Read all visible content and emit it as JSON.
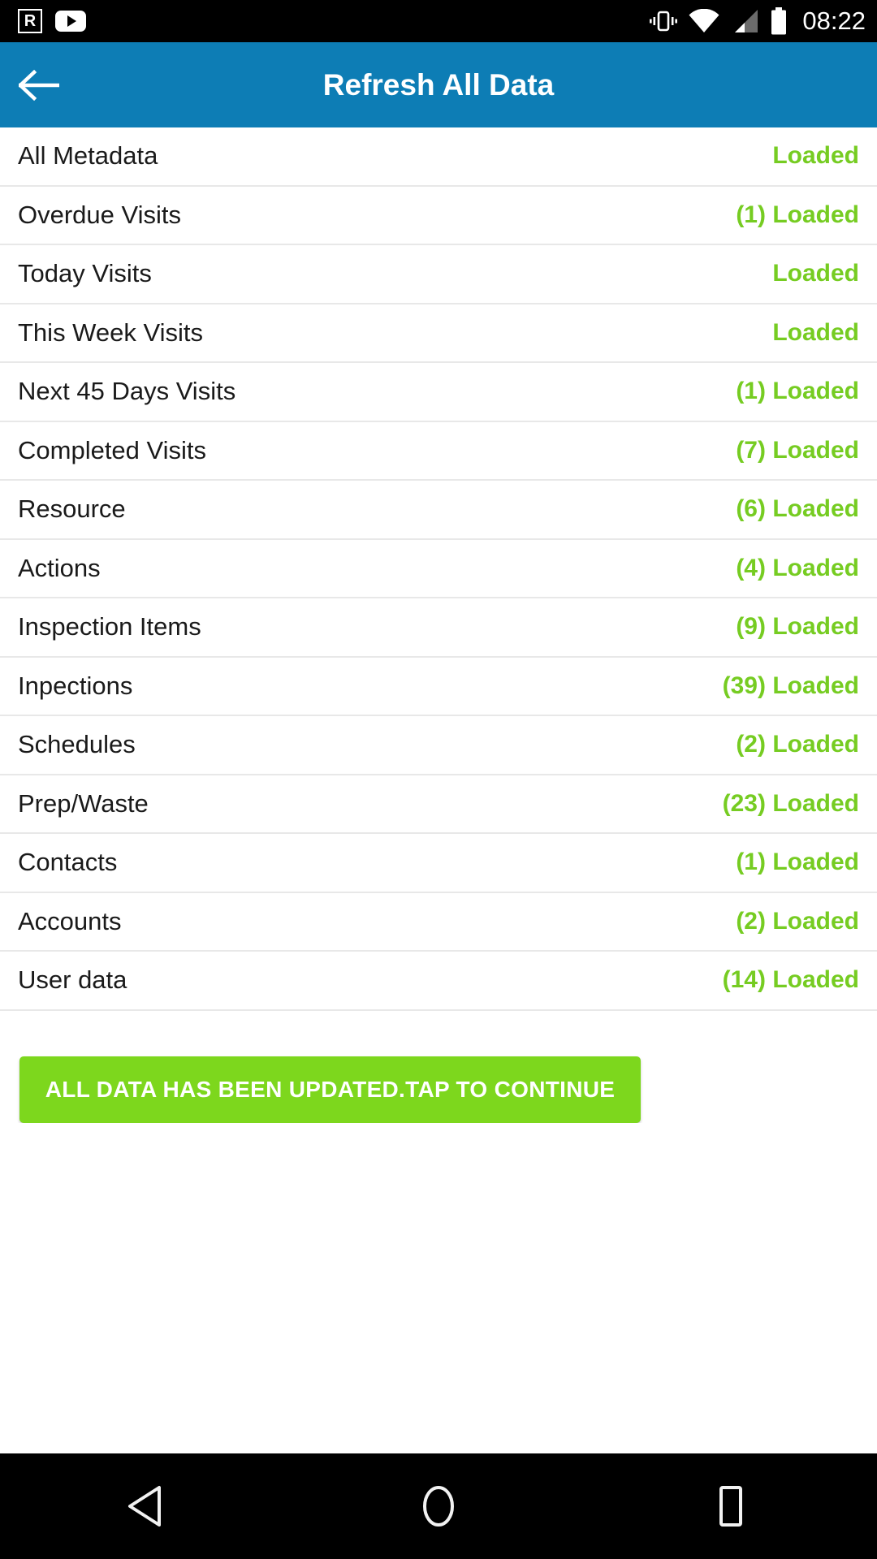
{
  "statusbar": {
    "time": "08:22",
    "left_icons": [
      "boxed-r-icon",
      "youtube-icon"
    ],
    "right_icons": [
      "vibrate-icon",
      "wifi-icon",
      "signal-icon",
      "battery-icon"
    ],
    "r_glyph": "R",
    "background": "#000000"
  },
  "header": {
    "title": "Refresh All Data",
    "back_icon": "back-arrow-icon",
    "background": "#0D7DB5",
    "text_color": "#FFFFFF"
  },
  "colors": {
    "status_green": "#76CC22",
    "button_green": "#7DD71D",
    "divider": "#E8E8E8",
    "label": "#1A1A1A"
  },
  "list": {
    "rows": [
      {
        "label": "All Metadata",
        "count": "",
        "status": "Loaded"
      },
      {
        "label": "Overdue Visits",
        "count": "(1)",
        "status": "Loaded"
      },
      {
        "label": "Today Visits",
        "count": "",
        "status": "Loaded"
      },
      {
        "label": "This Week Visits",
        "count": "",
        "status": "Loaded"
      },
      {
        "label": "Next 45 Days Visits",
        "count": "(1)",
        "status": "Loaded"
      },
      {
        "label": "Completed Visits",
        "count": "(7)",
        "status": "Loaded"
      },
      {
        "label": "Resource",
        "count": "(6)",
        "status": "Loaded"
      },
      {
        "label": "Actions",
        "count": "(4)",
        "status": "Loaded"
      },
      {
        "label": "Inspection Items",
        "count": "(9)",
        "status": "Loaded"
      },
      {
        "label": "Inpections",
        "count": "(39)",
        "status": "Loaded"
      },
      {
        "label": "Schedules",
        "count": "(2)",
        "status": "Loaded"
      },
      {
        "label": "Prep/Waste",
        "count": "(23)",
        "status": "Loaded"
      },
      {
        "label": "Contacts",
        "count": "(1)",
        "status": "Loaded"
      },
      {
        "label": "Accounts",
        "count": "(2)",
        "status": "Loaded"
      },
      {
        "label": "User data",
        "count": "(14)",
        "status": "Loaded"
      }
    ]
  },
  "cta": {
    "label": "ALL DATA HAS BEEN UPDATED.TAP TO CONTINUE"
  },
  "navbar": {
    "back_icon": "nav-back-triangle-icon",
    "home_icon": "nav-home-circle-icon",
    "recents_icon": "nav-recents-square-icon"
  }
}
